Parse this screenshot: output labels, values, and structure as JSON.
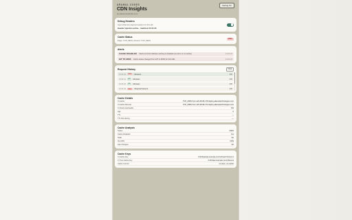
{
  "header": {
    "brand": "ARAMAL CODES",
    "title": "CDN Insights",
    "subtitle": "cp.kasonnestrick2.com",
    "debug_label": "Debug On"
  },
  "debug_headers": {
    "title": "Debug Headers",
    "desc": "Inject Akamai pragma headers for this tab",
    "status": "Header injection active · matched 14:31:23",
    "enabled": true
  },
  "cache_status": {
    "title": "Cache Status",
    "desc": "Edge: TCP_MISS | Parent: TCP_MISS",
    "badge": "MISS"
  },
  "alerts": {
    "title": "Alerts",
    "items": [
      {
        "tag": "CACHE DISABLED",
        "msg": "Cache-Control indicates caching is disabled (no-store or no-cache)",
        "time": "14:31:22"
      },
      {
        "tag": "HIT TO MISS",
        "msg": "Cache status changed from HIT to MISS for this URL",
        "time": "14:31:22"
      }
    ]
  },
  "request_history": {
    "title": "Request History",
    "clear_label": "Clear",
    "items": [
      {
        "time": "14:31:22",
        "method": "MISS",
        "path": "/v3/users",
        "status": "200",
        "active": true
      },
      {
        "time": "14:31:21",
        "method": "HIT",
        "path": "/v3/users",
        "status": "200",
        "active": false
      },
      {
        "time": "14:31:20",
        "method": "HIT",
        "path": "/v3/users",
        "status": "200",
        "active": false
      },
      {
        "time": "14:31:19",
        "method": "MISS",
        "path": "/v3/posts?since=1",
        "status": "200",
        "active": false
      }
    ]
  },
  "cache_details": {
    "title": "Cache Details",
    "rows": [
      {
        "k": "X-Cache",
        "v": "TCP_MISS from a23-48-96-178.deploy.akamaitechnologies.com"
      },
      {
        "k": "X-Cache-Remote",
        "v": "TCP_MISS from a23-48-96-172.deploy.akamaitechnologies.com"
      },
      {
        "k": "X-Check-Cacheable",
        "v": "NO"
      },
      {
        "k": "Age",
        "v": "0"
      },
      {
        "k": "TTL",
        "v": "—"
      },
      {
        "k": "TTL Remaining",
        "v": "—"
      }
    ]
  },
  "cache_analysis": {
    "title": "Cache Analysis",
    "rows": [
      {
        "k": "Status",
        "v": "MISS"
      },
      {
        "k": "Cache Disabled",
        "v": "Yes"
      },
      {
        "k": "Stale",
        "v": "No"
      },
      {
        "k": "Via CDN",
        "v": "CDN"
      },
      {
        "k": "Has Changes",
        "v": "No"
      }
    ]
  },
  "cache_keys": {
    "title": "Cache Keys",
    "rows": [
      {
        "k": "X-Cache-Key",
        "v": "/L/1/https/api.example.com/v3/users?since=1"
      },
      {
        "k": "X-True-Cache-Key",
        "v": "/L/0/1/api.example.com/v3/users"
      },
      {
        "k": "Cache Control",
        "v": "no-store, no-cache"
      }
    ]
  }
}
